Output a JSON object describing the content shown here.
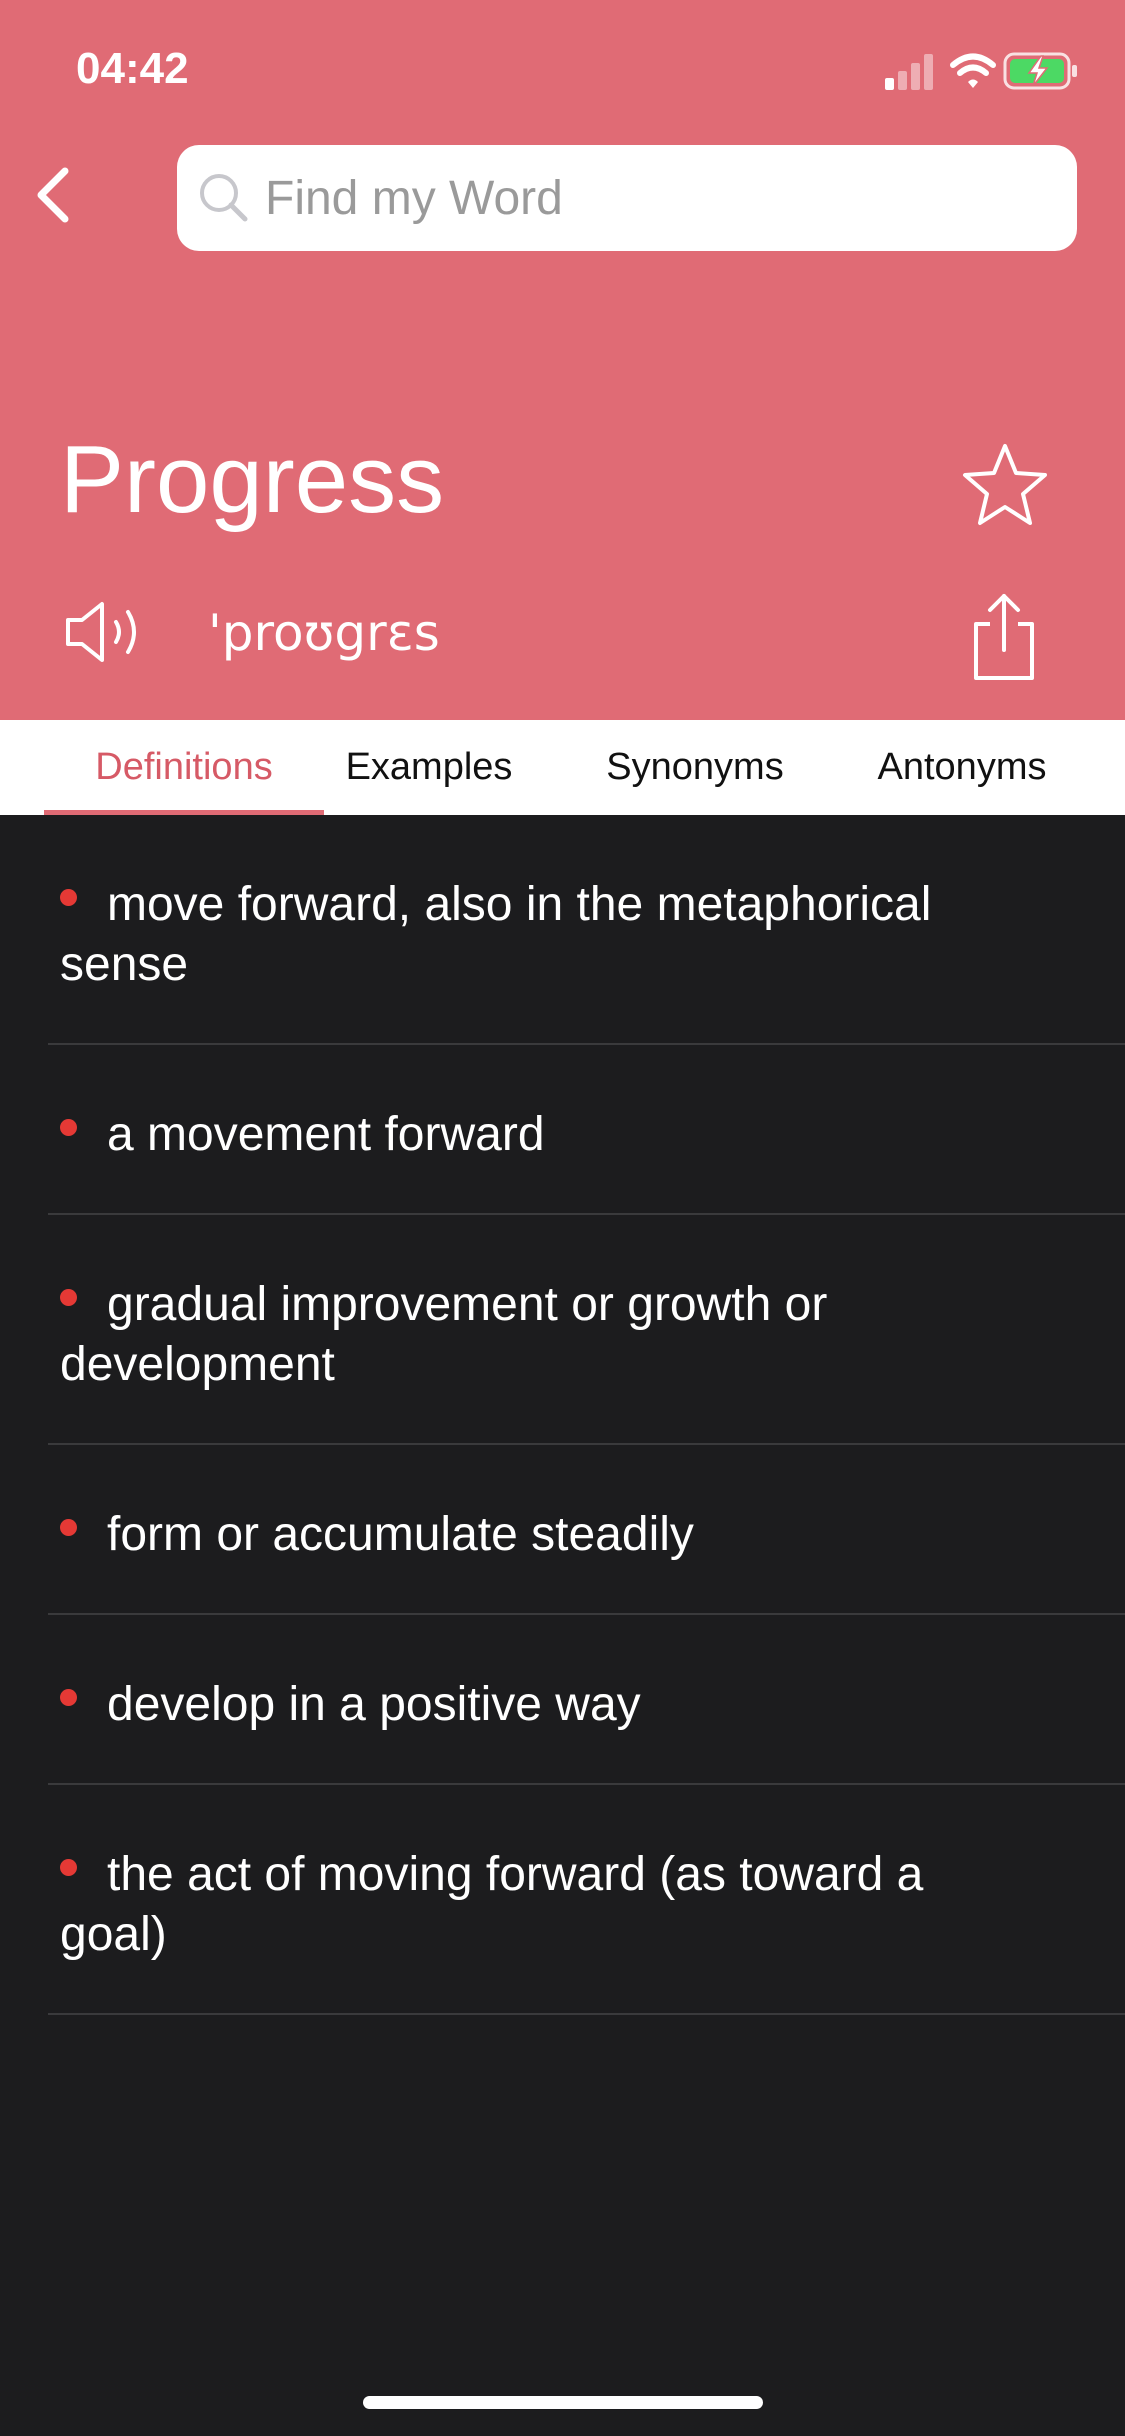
{
  "status_bar": {
    "time": "04:42"
  },
  "search": {
    "placeholder": "Find my Word",
    "value": ""
  },
  "word": {
    "title": "Progress",
    "phonetic": "'proʊgrɛs"
  },
  "tabs": [
    {
      "label": "Definitions",
      "active": true
    },
    {
      "label": "Examples",
      "active": false
    },
    {
      "label": "Synonyms",
      "active": false
    },
    {
      "label": "Antonyms",
      "active": false
    }
  ],
  "definitions": [
    "move forward, also in the metaphorical sense",
    "a movement forward",
    "gradual improvement or growth or development",
    "form or accumulate steadily",
    "develop in a positive way",
    "the act of moving forward (as toward a goal)"
  ],
  "colors": {
    "header": "#e06b75",
    "accent": "#d65a66",
    "bullet": "#e53935",
    "background": "#1c1c1e"
  },
  "icons": [
    "signal-icon",
    "wifi-icon",
    "battery-charging-icon",
    "back-arrow-icon",
    "search-icon",
    "star-icon",
    "speaker-icon",
    "share-icon"
  ]
}
